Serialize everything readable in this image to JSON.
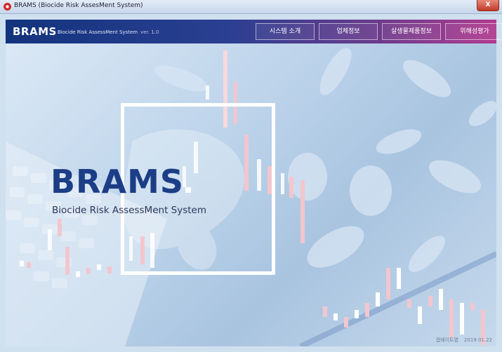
{
  "window": {
    "title": "BRAMS (Biocide Risk AssesMent System)",
    "close_label": "X"
  },
  "header": {
    "logo": "BRAMS",
    "subtitle": "Biocide Risk AssessMent System",
    "version": "ver. 1.0"
  },
  "nav": [
    {
      "label": "시스템 소개"
    },
    {
      "label": "업체정보"
    },
    {
      "label": "살생물제품정보"
    },
    {
      "label": "위해성평가"
    }
  ],
  "hero": {
    "title": "BRAMS",
    "subtitle": "Biocide Risk AssessMent System"
  },
  "footer": {
    "author": "캡웨이트랩",
    "date": "2019.01.22"
  },
  "colors": {
    "header_start": "#13337d",
    "header_end": "#b23a8f",
    "hero_title": "#1b3e86"
  }
}
